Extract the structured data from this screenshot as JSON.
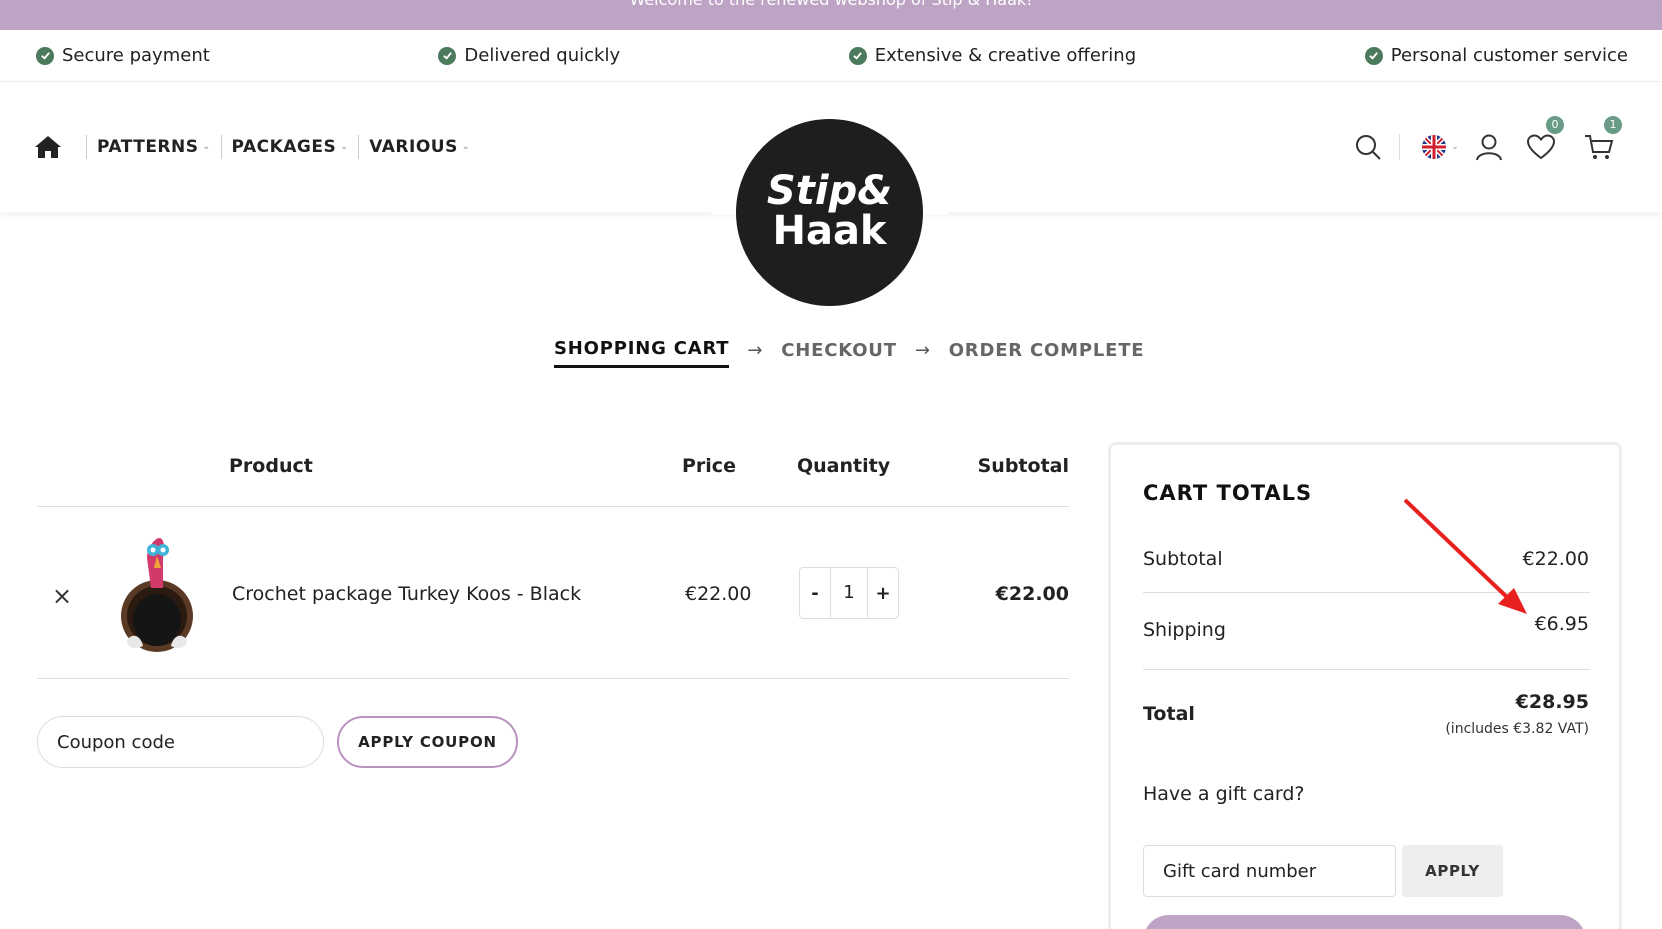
{
  "announcement": "Welcome to the renewed webshop of Stip & Haak!",
  "usps": [
    "Secure payment",
    "Delivered quickly",
    "Extensive & creative offering",
    "Personal customer service"
  ],
  "nav": {
    "items": [
      "PATTERNS",
      "PACKAGES",
      "VARIOUS"
    ]
  },
  "logo": {
    "line1": "Stip&",
    "line2": "Haak"
  },
  "header_icons": {
    "wishlist_count": "0",
    "cart_count": "1"
  },
  "steps": {
    "cart": "SHOPPING CART",
    "checkout": "CHECKOUT",
    "complete": "ORDER COMPLETE",
    "arrow": "→"
  },
  "cart_table": {
    "headers": {
      "product": "Product",
      "price": "Price",
      "quantity": "Quantity",
      "subtotal": "Subtotal"
    },
    "rows": [
      {
        "name": "Crochet package Turkey Koos - Black",
        "price": "€22.00",
        "qty": "1",
        "subtotal": "€22.00"
      }
    ],
    "qty_minus": "-",
    "qty_plus": "+"
  },
  "coupon": {
    "placeholder": "Coupon code",
    "button": "APPLY COUPON"
  },
  "totals": {
    "title": "CART TOTALS",
    "subtotal_label": "Subtotal",
    "subtotal_value": "€22.00",
    "shipping_label": "Shipping",
    "shipping_value": "€6.95",
    "total_label": "Total",
    "total_value": "€28.95",
    "vat_note": "(includes €3.82 VAT)",
    "gift_label": "Have a gift card?",
    "gift_placeholder": "Gift card number",
    "gift_button": "APPLY"
  },
  "colors": {
    "brand_purple": "#bda3c4",
    "check_green": "#4b7a5c",
    "badge_green": "#6a9b86",
    "annotation_red": "#e8201e"
  }
}
